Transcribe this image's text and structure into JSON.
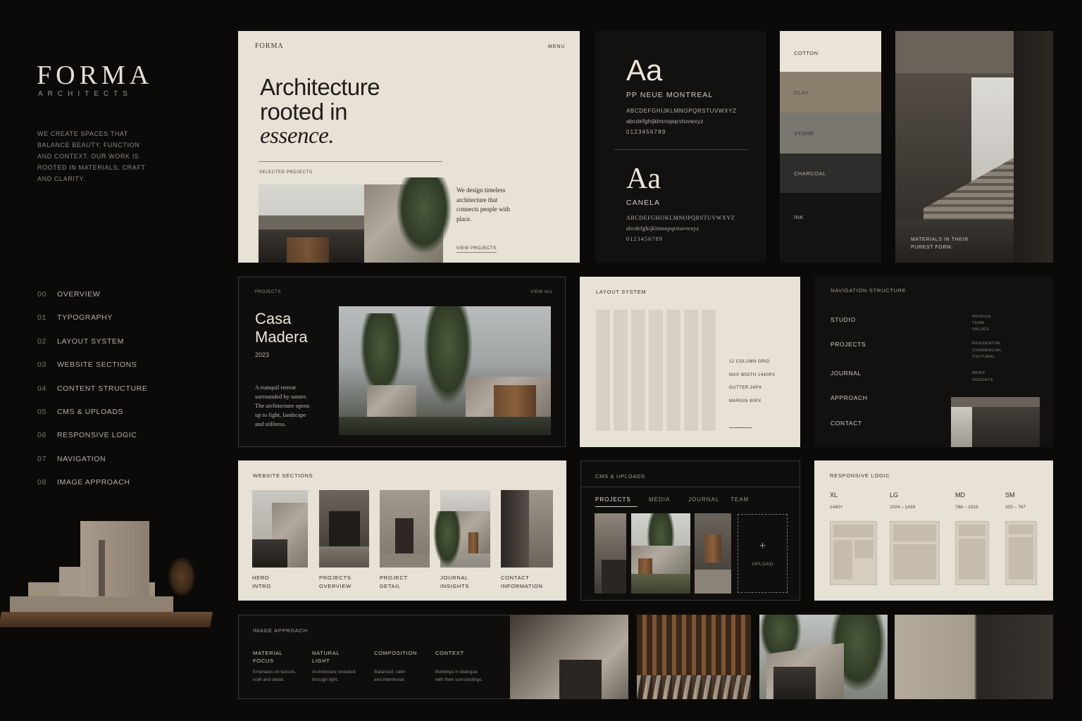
{
  "brand": {
    "title": "FORMA",
    "subtitle": "ARCHITECTS",
    "description": "WE CREATE SPACES THAT BALANCE BEAUTY, FUNCTION AND CONTEXT. OUR WORK IS ROOTED IN MATERIALS, CRAFT AND CLARITY."
  },
  "toc": [
    {
      "num": "00",
      "label": "OVERVIEW"
    },
    {
      "num": "01",
      "label": "TYPOGRAPHY"
    },
    {
      "num": "02",
      "label": "LAYOUT SYSTEM"
    },
    {
      "num": "03",
      "label": "WEBSITE SECTIONS"
    },
    {
      "num": "04",
      "label": "CONTENT STRUCTURE"
    },
    {
      "num": "05",
      "label": "CMS & UPLOADS"
    },
    {
      "num": "06",
      "label": "RESPONSIVE LOGIC"
    },
    {
      "num": "07",
      "label": "NAVIGATION"
    },
    {
      "num": "08",
      "label": "IMAGE APPROACH"
    }
  ],
  "hero": {
    "logo": "FORMA",
    "menu": "MENU",
    "headline_1": "Architecture",
    "headline_2": "rooted in",
    "headline_3": "essence.",
    "selected": "SELECTED PROJECTS",
    "copy": "We design timeless architecture that connects people with place.",
    "view": "VIEW PROJECTS"
  },
  "typography": {
    "sans_aa": "Aa",
    "sans_name": "PP NEUE MONTREAL",
    "sans_upper": "ABCDEFGHIJKLMNOPQRSTUVWXYZ",
    "sans_lower": "abcdefghijklmnopqrstuvwxyz",
    "sans_digits": "0123456789",
    "serif_aa": "Aa",
    "serif_name": "CANELA",
    "serif_upper": "ABCDEFGHIJKLMNOPQRSTUVWXYZ",
    "serif_lower": "abcdefghijklmnopqrstuvwxyz",
    "serif_digits": "0123456789"
  },
  "palette": [
    {
      "name": "COTTON",
      "color": "#e9e3d8"
    },
    {
      "name": "CLAY",
      "color": "#8c7f6e"
    },
    {
      "name": "STONE",
      "color": "#7a7670"
    },
    {
      "name": "CHARCOAL",
      "color": "#2f2d2b"
    },
    {
      "name": "INK",
      "color": "#151413"
    }
  ],
  "stair": {
    "caption": "MATERIALS IN THEIR PUREST FORM."
  },
  "project": {
    "label": "PROJECTS",
    "view_all": "VIEW ALL",
    "name_1": "Casa",
    "name_2": "Madera",
    "year": "2023",
    "desc": "A tranquil retreat surrounded by nature. The architecture opens up to light, landscape and stillness."
  },
  "layout": {
    "title": "LAYOUT SYSTEM",
    "specs": [
      "12 COLUMN GRID",
      "MAX WIDTH 1440PX",
      "GUTTER 24PX",
      "MARGIN 80PX"
    ]
  },
  "navigation": {
    "title": "NAVIGATION STRUCTURE",
    "items": [
      "STUDIO",
      "PROJECTS",
      "JOURNAL",
      "APPROACH",
      "CONTACT"
    ],
    "sub_studio": [
      "PROFILE",
      "TEAM",
      "VALUES"
    ],
    "sub_projects": [
      "RESIDENTIAL",
      "COMMERCIAL",
      "CULTURAL"
    ],
    "sub_journal": [
      "NEWS",
      "INSIGHTS"
    ]
  },
  "sections": {
    "title": "WEBSITE SECTIONS",
    "items": [
      {
        "a": "HERO",
        "b": "INTRO"
      },
      {
        "a": "PROJECTS",
        "b": "OVERVIEW"
      },
      {
        "a": "PROJECT",
        "b": "DETAIL"
      },
      {
        "a": "JOURNAL",
        "b": "INSIGHTS"
      },
      {
        "a": "CONTACT",
        "b": "INFORMATION"
      }
    ]
  },
  "cms": {
    "title": "CMS & UPLOADS",
    "tabs": [
      "PROJECTS",
      "MEDIA",
      "JOURNAL",
      "TEAM"
    ],
    "upload": "UPLOAD",
    "plus": "+"
  },
  "responsive": {
    "title": "RESPONSIVE LOGIC",
    "items": [
      {
        "label": "XL",
        "range": "1440+"
      },
      {
        "label": "LG",
        "range": "1024 – 1439"
      },
      {
        "label": "MD",
        "range": "768 – 1023"
      },
      {
        "label": "SM",
        "range": "320 – 767"
      }
    ]
  },
  "image_approach": {
    "title": "IMAGE APPROACH",
    "items": [
      {
        "h1": "MATERIAL",
        "h2": "FOCUS",
        "t1": "Emphasis on texture,",
        "t2": "craft and detail."
      },
      {
        "h1": "NATURAL",
        "h2": "LIGHT",
        "t1": "Architecture revealed",
        "t2": "through light."
      },
      {
        "h1": "COMPOSITION",
        "h2": "",
        "t1": "Balanced, calm",
        "t2": "and intentional."
      },
      {
        "h1": "CONTEXT",
        "h2": "",
        "t1": "Buildings in dialogue",
        "t2": "with their surroundings."
      }
    ]
  }
}
